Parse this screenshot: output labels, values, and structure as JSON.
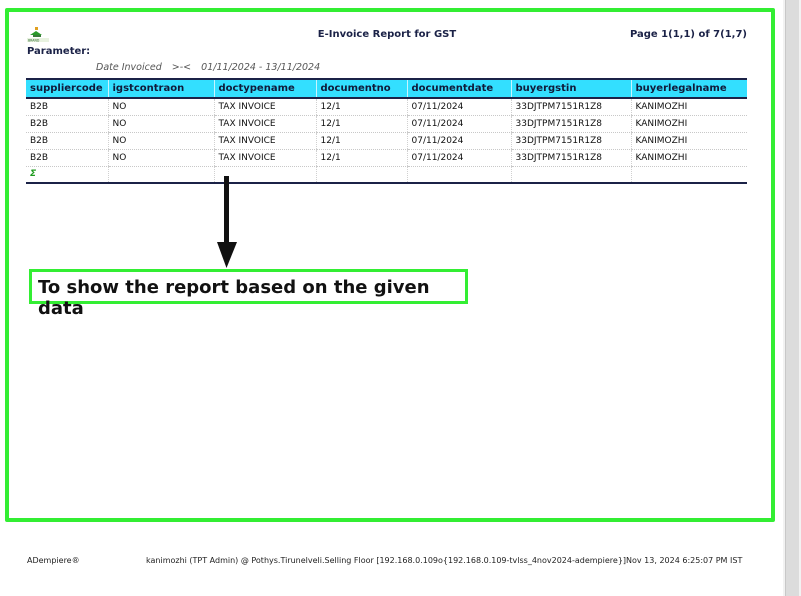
{
  "report": {
    "title": "E-Invoice Report for GST",
    "page_info": "Page 1(1,1) of 7(1,7)",
    "parameter_label": "Parameter:",
    "parameter": {
      "name": "Date Invoiced",
      "operator": ">-<",
      "value": "01/11/2024 - 13/11/2024"
    }
  },
  "table": {
    "columns": [
      "suppliercode",
      "igstcontraon",
      "doctypename",
      "documentno",
      "documentdate",
      "buyergstin",
      "buyerlegalname"
    ],
    "rows": [
      [
        "B2B",
        "NO",
        "TAX INVOICE",
        "12/1",
        "07/11/2024",
        "33DJTPM7151R1Z8",
        "KANIMOZHI"
      ],
      [
        "B2B",
        "NO",
        "TAX INVOICE",
        "12/1",
        "07/11/2024",
        "33DJTPM7151R1Z8",
        "KANIMOZHI"
      ],
      [
        "B2B",
        "NO",
        "TAX INVOICE",
        "12/1",
        "07/11/2024",
        "33DJTPM7151R1Z8",
        "KANIMOZHI"
      ],
      [
        "B2B",
        "NO",
        "TAX INVOICE",
        "12/1",
        "07/11/2024",
        "33DJTPM7151R1Z8",
        "KANIMOZHI"
      ]
    ],
    "total_symbol": "Σ"
  },
  "annotation": {
    "text": "To show the report based on the given data"
  },
  "footer": {
    "left": "ADempiere®",
    "right": "kanimozhi (TPT Admin) @ Pothys.Tirunelveli.Selling Floor [192.168.0.109o{192.168.0.109-tvlss_4nov2024-adempiere}]Nov 13, 2024 6:25:07 PM IST"
  },
  "colors": {
    "highlight_border": "#33ee33",
    "header_bg": "#33dfff",
    "title_text": "#1b2247"
  },
  "icons": {
    "logo": "company-logo",
    "arrow": "down-arrow-icon"
  }
}
